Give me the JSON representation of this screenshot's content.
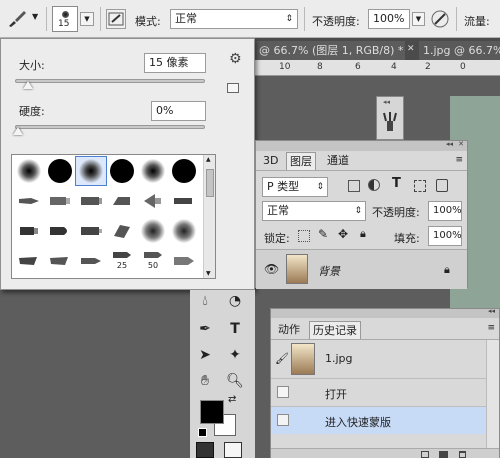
{
  "options_bar": {
    "brush_size": "15",
    "mode_label": "模式:",
    "mode_value": "正常",
    "opacity_label": "不透明度:",
    "opacity_value": "100%",
    "flow_label": "流量:"
  },
  "document_tabs": [
    {
      "label": "@ 66.7% (图层 1, RGB/8) *"
    },
    {
      "label": "1.jpg @ 66.7%"
    }
  ],
  "ruler": {
    "ticks": [
      "10",
      "8",
      "6",
      "4",
      "2",
      "0"
    ]
  },
  "brush_panel": {
    "size_label": "大小:",
    "size_value": "15 像素",
    "hardness_label": "硬度:",
    "hardness_value": "0%",
    "size_slider_fraction": 0.07,
    "hardness_slider_fraction": 0.0,
    "preset_numbers": [
      "25",
      "50"
    ]
  },
  "layers_panel": {
    "tabs": [
      "3D",
      "图层",
      "通道"
    ],
    "active_tab": "图层",
    "filter_label": "P 类型",
    "blend_mode": "正常",
    "opacity_label": "不透明度:",
    "opacity_value": "100%",
    "lock_label": "锁定:",
    "fill_label": "填充:",
    "fill_value": "100%",
    "layers": [
      {
        "name": "背景",
        "locked": true,
        "visible": true
      }
    ]
  },
  "history_panel": {
    "tabs": [
      "动作",
      "历史记录"
    ],
    "active_tab": "历史记录",
    "snapshot": "1.jpg",
    "states": [
      {
        "label": "打开",
        "selected": false
      },
      {
        "label": "进入快速蒙版",
        "selected": true
      }
    ]
  },
  "colors": {
    "foreground": "#000000",
    "background": "#ffffff",
    "panel_bg": "#d9d9d9",
    "selected_row": "#c7daf6",
    "canvas": "#8da496"
  }
}
